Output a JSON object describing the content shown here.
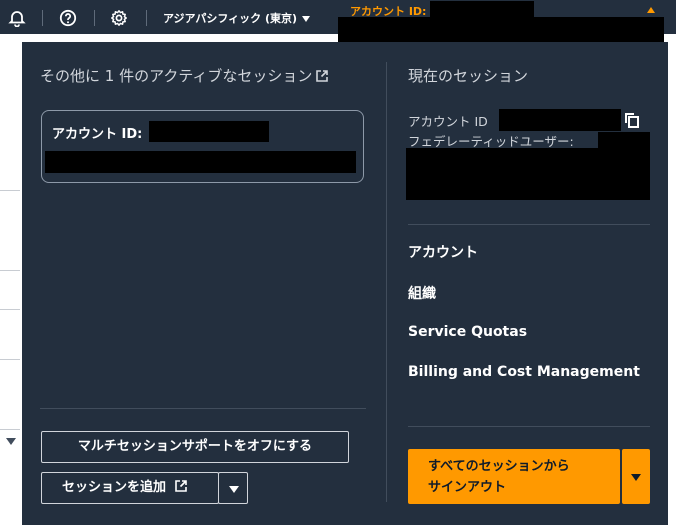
{
  "nav": {
    "region_label": "アジアパシフィック (東京)",
    "account_label": "アカウント ID:",
    "icons": [
      "bell-icon",
      "help-icon",
      "gear-icon"
    ]
  },
  "panel": {
    "left": {
      "title": "その他に 1 件のアクティブなセッション",
      "session_card": {
        "account_label": "アカウント ID:"
      },
      "multi_session_off_label": "マルチセッションサポートをオフにする",
      "add_session_label": "セッションを追加"
    },
    "right": {
      "title": "現在のセッション",
      "account_id_label": "アカウント ID",
      "federated_user_label": "フェデレーティッドユーザー:",
      "menu": [
        "アカウント",
        "組織",
        "Service Quotas",
        "Billing and Cost Management"
      ],
      "signout_label": "すべてのセッションから\nサインアウト"
    }
  },
  "colors": {
    "nav_bg": "#232f3e",
    "accent": "#ff9900",
    "text": "#ffffff"
  }
}
